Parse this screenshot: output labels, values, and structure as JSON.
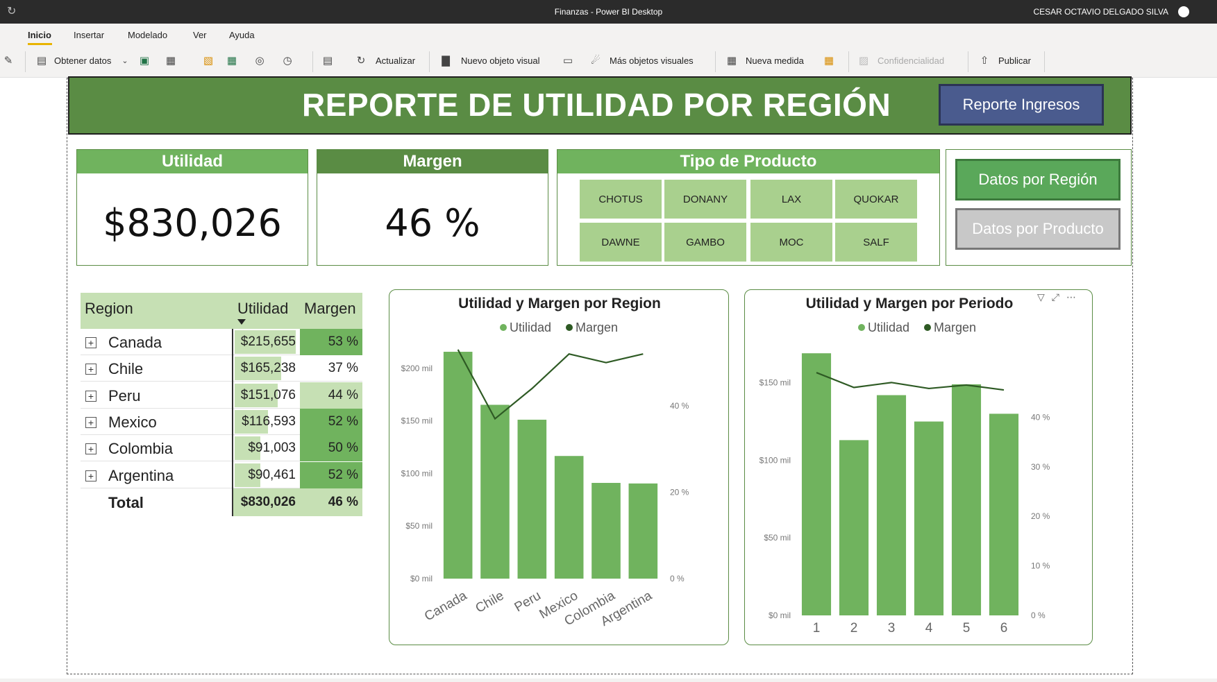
{
  "window": {
    "title": "Finanzas - Power BI Desktop",
    "user": "CESAR OCTAVIO DELGADO SILVA"
  },
  "menu": [
    "Inicio",
    "Insertar",
    "Modelado",
    "Ver",
    "Ayuda"
  ],
  "toolbar": {
    "obtener_datos": "Obtener datos",
    "actualizar": "Actualizar",
    "nuevo_objeto": "Nuevo objeto visual",
    "mas_objetos": "Más objetos visuales",
    "nueva_medida": "Nueva medida",
    "confidencialidad": "Confidencialidad",
    "publicar": "Publicar"
  },
  "report": {
    "title": "REPORTE DE UTILIDAD POR REGIÓN",
    "btn_ingresos": "Reporte Ingresos",
    "kpi_utilidad_label": "Utilidad",
    "kpi_utilidad_value": "$830,026",
    "kpi_margen_label": "Margen",
    "kpi_margen_value": "46 %",
    "slicer_title": "Tipo de Producto",
    "slicer_items": [
      "CHOTUS",
      "DONANY",
      "LAX",
      "QUOKAR",
      "DAWNE",
      "GAMBO",
      "MOC",
      "SALF"
    ],
    "btn_region": "Datos por Región",
    "btn_producto": "Datos por Producto"
  },
  "table": {
    "headers": [
      "Region",
      "Utilidad",
      "Margen"
    ],
    "rows": [
      {
        "region": "Canada",
        "utilidad": "$215,655",
        "margen": "53 %",
        "u": 215655,
        "m": 53
      },
      {
        "region": "Chile",
        "utilidad": "$165,238",
        "margen": "37 %",
        "u": 165238,
        "m": 37
      },
      {
        "region": "Peru",
        "utilidad": "$151,076",
        "margen": "44 %",
        "u": 151076,
        "m": 44
      },
      {
        "region": "Mexico",
        "utilidad": "$116,593",
        "margen": "52 %",
        "u": 116593,
        "m": 52
      },
      {
        "region": "Colombia",
        "utilidad": "$91,003",
        "margen": "50 %",
        "u": 91003,
        "m": 50
      },
      {
        "region": "Argentina",
        "utilidad": "$90,461",
        "margen": "52 %",
        "u": 90461,
        "m": 52
      }
    ],
    "total_label": "Total",
    "total_utilidad": "$830,026",
    "total_margen": "46 %"
  },
  "chart_data": [
    {
      "type": "bar",
      "title": "Utilidad y Margen por Region",
      "legend": [
        "Utilidad",
        "Margen"
      ],
      "legend_position": "top",
      "categories": [
        "Canada",
        "Chile",
        "Peru",
        "Mexico",
        "Colombia",
        "Argentina"
      ],
      "series": [
        {
          "name": "Utilidad",
          "type": "bar",
          "axis": "left",
          "values": [
            215655,
            165238,
            151076,
            116593,
            91003,
            90461
          ]
        },
        {
          "name": "Margen",
          "type": "line",
          "axis": "right",
          "values": [
            53,
            37,
            44,
            52,
            50,
            52
          ]
        }
      ],
      "y_left": {
        "min": 0,
        "max": 200000,
        "ticks": [
          0,
          50000,
          100000,
          150000,
          200000
        ],
        "tick_labels": [
          "$0 mil",
          "$50 mil",
          "$100 mil",
          "$150 mil",
          "$200 mil"
        ]
      },
      "y_right": {
        "min": 0,
        "max": 40,
        "ticks": [
          0,
          20,
          40
        ],
        "tick_labels": [
          "0 %",
          "20 %",
          "40 %"
        ]
      },
      "colors": {
        "bar": "#70b35e",
        "line": "#2e5a24"
      }
    },
    {
      "type": "bar",
      "title": "Utilidad y Margen por Periodo",
      "legend": [
        "Utilidad",
        "Margen"
      ],
      "legend_position": "top",
      "categories": [
        "1",
        "2",
        "3",
        "4",
        "5",
        "6"
      ],
      "series": [
        {
          "name": "Utilidad",
          "type": "bar",
          "axis": "left",
          "values": [
            169000,
            113000,
            142000,
            125000,
            149000,
            130000
          ]
        },
        {
          "name": "Margen",
          "type": "line",
          "axis": "right",
          "values": [
            49,
            46,
            47,
            45.8,
            46.5,
            45.5
          ]
        }
      ],
      "y_left": {
        "min": 0,
        "max": 150000,
        "ticks": [
          0,
          50000,
          100000,
          150000
        ],
        "tick_labels": [
          "$0 mil",
          "$50 mil",
          "$100 mil",
          "$150 mil"
        ]
      },
      "y_right": {
        "min": 0,
        "max": 40,
        "ticks": [
          0,
          10,
          20,
          30,
          40
        ],
        "tick_labels": [
          "0 %",
          "10 %",
          "20 %",
          "30 %",
          "40 %"
        ]
      },
      "colors": {
        "bar": "#70b35e",
        "line": "#2e5a24"
      }
    }
  ],
  "colors": {
    "header_green": "#5a8c44",
    "light_green": "#70b35e",
    "pale_green": "#a9d08e",
    "table_green": "#c6e0b4",
    "navy_button": "#4a5b8e"
  }
}
